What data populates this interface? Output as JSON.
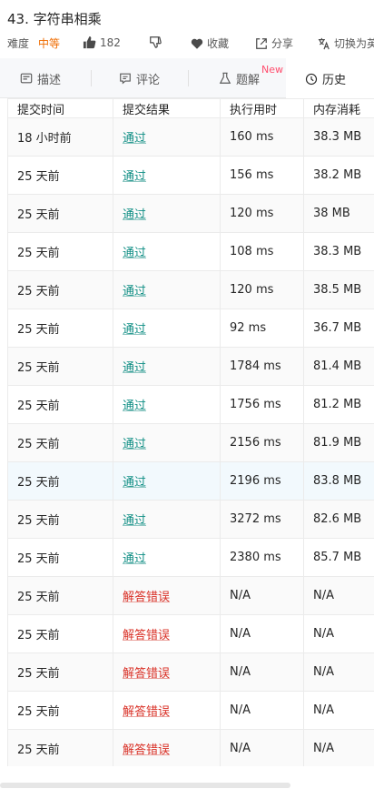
{
  "problem": {
    "title": "43. 字符串相乘",
    "difficulty_label": "难度",
    "difficulty_value": "中等",
    "likes": "182",
    "favorite_label": "收藏",
    "share_label": "分享",
    "translate_label": "切换为英文"
  },
  "tabs": [
    {
      "label": "描述",
      "icon": "description-icon"
    },
    {
      "label": "评论",
      "icon": "comment-icon"
    },
    {
      "label": "题解",
      "icon": "flask-icon",
      "badge": "New"
    },
    {
      "label": "历史",
      "icon": "clock-icon"
    }
  ],
  "table": {
    "headers": [
      "提交时间",
      "提交结果",
      "执行用时",
      "内存消耗"
    ],
    "rows": [
      {
        "time": "18 小时前",
        "result": "通过",
        "runtime": "160 ms",
        "memory": "38.3 MB",
        "status": "ok"
      },
      {
        "time": "25 天前",
        "result": "通过",
        "runtime": "156 ms",
        "memory": "38.2 MB",
        "status": "ok"
      },
      {
        "time": "25 天前",
        "result": "通过",
        "runtime": "120 ms",
        "memory": "38 MB",
        "status": "ok"
      },
      {
        "time": "25 天前",
        "result": "通过",
        "runtime": "108 ms",
        "memory": "38.3 MB",
        "status": "ok"
      },
      {
        "time": "25 天前",
        "result": "通过",
        "runtime": "120 ms",
        "memory": "38.5 MB",
        "status": "ok"
      },
      {
        "time": "25 天前",
        "result": "通过",
        "runtime": "92 ms",
        "memory": "36.7 MB",
        "status": "ok"
      },
      {
        "time": "25 天前",
        "result": "通过",
        "runtime": "1784 ms",
        "memory": "81.4 MB",
        "status": "ok"
      },
      {
        "time": "25 天前",
        "result": "通过",
        "runtime": "1756 ms",
        "memory": "81.2 MB",
        "status": "ok"
      },
      {
        "time": "25 天前",
        "result": "通过",
        "runtime": "2156 ms",
        "memory": "81.9 MB",
        "status": "ok"
      },
      {
        "time": "25 天前",
        "result": "通过",
        "runtime": "2196 ms",
        "memory": "83.8 MB",
        "status": "ok"
      },
      {
        "time": "25 天前",
        "result": "通过",
        "runtime": "3272 ms",
        "memory": "82.6 MB",
        "status": "ok"
      },
      {
        "time": "25 天前",
        "result": "通过",
        "runtime": "2380 ms",
        "memory": "85.7 MB",
        "status": "ok"
      },
      {
        "time": "25 天前",
        "result": "解答错误",
        "runtime": "N/A",
        "memory": "N/A",
        "status": "err"
      },
      {
        "time": "25 天前",
        "result": "解答错误",
        "runtime": "N/A",
        "memory": "N/A",
        "status": "err"
      },
      {
        "time": "25 天前",
        "result": "解答错误",
        "runtime": "N/A",
        "memory": "N/A",
        "status": "err"
      },
      {
        "time": "25 天前",
        "result": "解答错误",
        "runtime": "N/A",
        "memory": "N/A",
        "status": "err"
      },
      {
        "time": "25 天前",
        "result": "解答错误",
        "runtime": "N/A",
        "memory": "N/A",
        "status": "err"
      }
    ]
  },
  "colors": {
    "accent_ok": "#0f8e84",
    "accent_err": "#d93026",
    "difficulty": "#ef6c00",
    "new_badge": "#ff4d6d"
  }
}
